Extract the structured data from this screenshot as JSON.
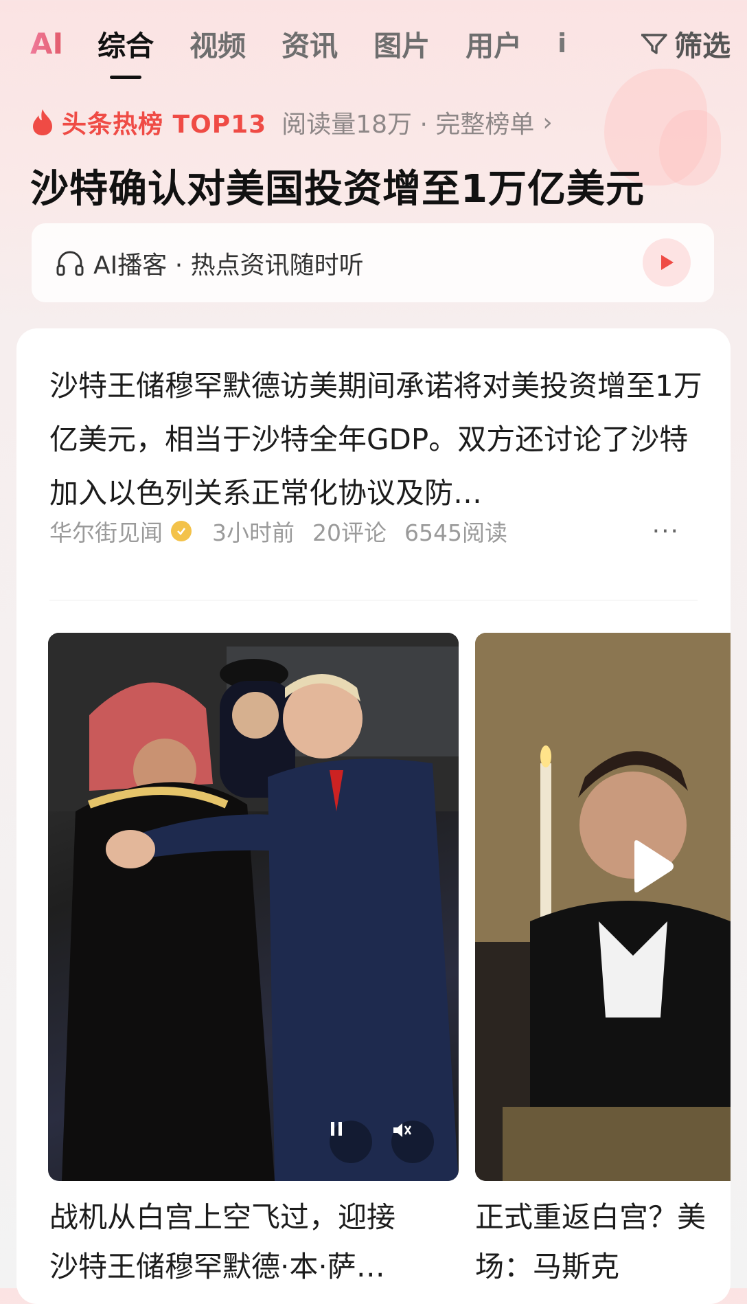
{
  "tabs": {
    "ai_logo": "AI",
    "items": [
      "综合",
      "视频",
      "资讯",
      "图片",
      "用户"
    ],
    "more": "i",
    "filter_label": "筛选"
  },
  "hot": {
    "title": "头条热榜 TOP13",
    "meta": "阅读量18万 · 完整榜单",
    "chevron": "›"
  },
  "headline": "沙特确认对美国投资增至1万亿美元",
  "podcast": {
    "label": "AI播客 · 热点资讯随时听"
  },
  "card": {
    "summary": "沙特王储穆罕默德访美期间承诺将对美投资增至1万亿美元，相当于沙特全年GDP。双方还讨论了沙特加入以色列关系正常化协议及防…",
    "source": "华尔街见闻",
    "time": "3小时前",
    "comments": "20评论",
    "reads": "6545阅读",
    "more": "···"
  },
  "videos": [
    {
      "caption_line1": "战机从白宫上空飞过，迎接",
      "caption_line2": "沙特王储穆罕默德·本·萨…"
    },
    {
      "caption_line1": "正式重返白宫？美",
      "caption_line2": "场：马斯克"
    }
  ],
  "colors": {
    "accent": "#ef4b45",
    "play": "#ef4b45"
  }
}
